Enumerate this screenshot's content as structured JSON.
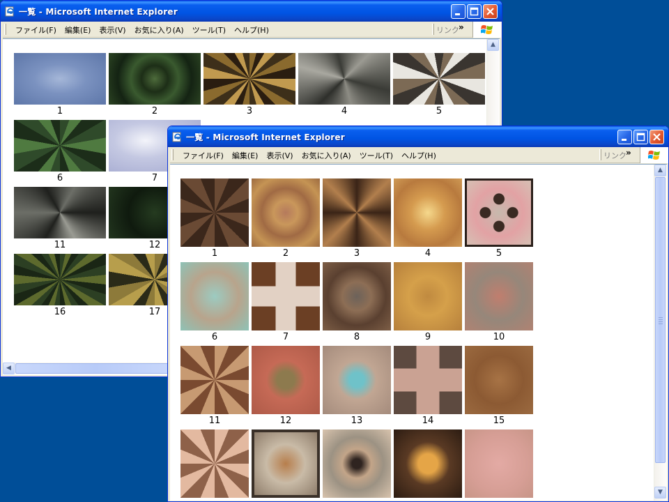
{
  "windows": {
    "back": {
      "title": "一覧 - Microsoft Internet Explorer",
      "menu": [
        "ファイル(F)",
        "編集(E)",
        "表示(V)",
        "お気に入り(A)",
        "ツール(T)",
        "ヘルプ(H)"
      ],
      "links_label": "リンク",
      "links_chevron": "»",
      "captions": [
        "1",
        "2",
        "3",
        "4",
        "5",
        "6",
        "7",
        "11",
        "12",
        "16",
        "17"
      ]
    },
    "front": {
      "title": "一覧 - Microsoft Internet Explorer",
      "menu": [
        "ファイル(F)",
        "編集(E)",
        "表示(V)",
        "お気に入り(A)",
        "ツール(T)",
        "ヘルプ(H)"
      ],
      "links_label": "リンク",
      "links_chevron": "»",
      "captions": [
        "1",
        "2",
        "3",
        "4",
        "5",
        "6",
        "7",
        "8",
        "9",
        "10",
        "11",
        "12",
        "13",
        "14",
        "15"
      ]
    }
  },
  "colors": {
    "desktop": "#004e98",
    "title_blue": "#0054e3",
    "close_red": "#e3582f",
    "chrome": "#ece9d8"
  },
  "icons": [
    "ie-icon",
    "minimize-icon",
    "maximize-icon",
    "close-icon",
    "windows-logo-icon",
    "scroll-up-icon",
    "scroll-down-icon",
    "scroll-left-icon"
  ]
}
